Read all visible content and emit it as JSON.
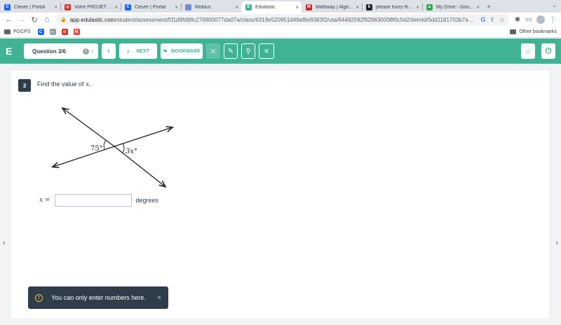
{
  "browser": {
    "tabs": [
      {
        "title": "Clever | Portal",
        "icon": "clever-icon",
        "icon_glyph": "C",
        "color": "#1464ff"
      },
      {
        "title": "Votre PROJET d…",
        "icon": "gear-icon",
        "icon_glyph": "⚙",
        "color": "#d93025"
      },
      {
        "title": "Clever | Portal",
        "icon": "clever-icon",
        "icon_glyph": "C",
        "color": "#1464ff"
      },
      {
        "title": "Mobius",
        "icon": "mobius-icon",
        "icon_glyph": "",
        "color": "#6e8cd6"
      },
      {
        "title": "Edulastic",
        "icon": "edulastic-icon",
        "icon_glyph": "E",
        "color": "#40b394",
        "active": true
      },
      {
        "title": "Mathway | Algeb…",
        "icon": "mathway-icon",
        "icon_glyph": "M",
        "color": "#c62828"
      },
      {
        "title": "please hurry tha…",
        "icon": "brainly-icon",
        "icon_glyph": "b",
        "color": "#202124"
      },
      {
        "title": "My Drive - Googl…",
        "icon": "drive-icon",
        "icon_glyph": "▲",
        "color": "#34a853"
      }
    ],
    "close_glyph": "×",
    "newtab_glyph": "+",
    "url_host": "app.edulastic.com",
    "url_path": "/student/assessment/5f1d9fd98c276900077da07a/class/6318e520951d49af6e9363f2/uta/64492592f929630008f0c5d2/itemId/5dd1181703b7ad092…",
    "bookmarks": [
      {
        "label": "PGCPS",
        "icon": "folder-icon"
      }
    ],
    "bookmark_icons": [
      {
        "name": "clever-bookmark-icon",
        "glyph": "C",
        "color": "#1464ff"
      },
      {
        "name": "edge-bookmark-icon",
        "glyph": "◐",
        "color": "#9aa0a6"
      },
      {
        "name": "gear-bookmark-icon",
        "glyph": "⚙",
        "color": "#d93025"
      },
      {
        "name": "gmail-bookmark-icon",
        "glyph": "M",
        "color": "#ea4335"
      }
    ],
    "other_bookmarks": "Other bookmarks"
  },
  "header": {
    "logo": "E",
    "question_select": "Question 3/6",
    "next_label": "NEXT",
    "bookmark_label": "BOOKMARK",
    "accent": "#40b394"
  },
  "question": {
    "number": "3",
    "prompt": "Find the value of",
    "variable": "x",
    "figure": {
      "angle_left": "75°",
      "angle_right": "3x°"
    },
    "answer_var_label": "x =",
    "answer_value": "",
    "unit": "degrees"
  },
  "toast": {
    "message": "You can only enter numbers here.",
    "warn_glyph": "!",
    "close_glyph": "×"
  }
}
